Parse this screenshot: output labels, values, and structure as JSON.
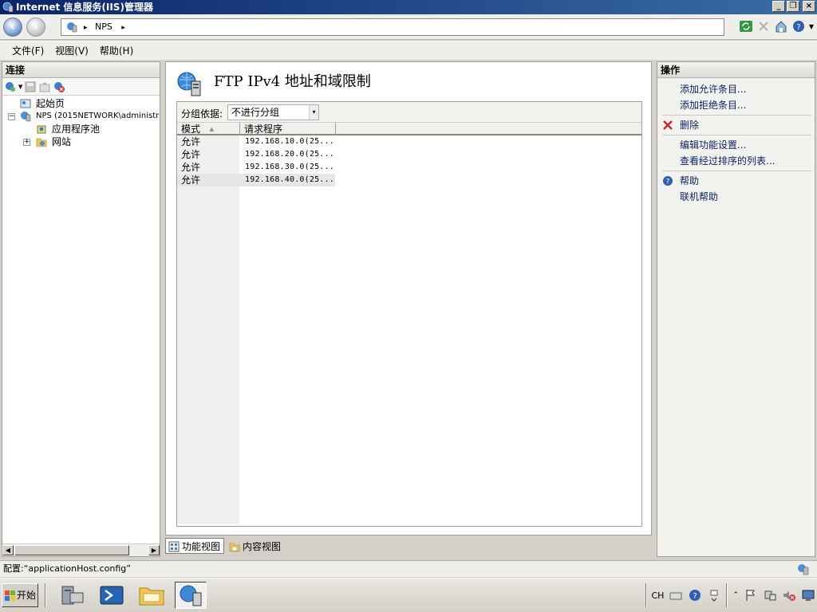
{
  "window": {
    "title": "Internet 信息服务(IIS)管理器",
    "min_label": "_",
    "max_label": "❐",
    "close_label": "×"
  },
  "address": {
    "back_label": "‹",
    "forward_label": "›",
    "sep1": "▸",
    "crumb": "NPS",
    "sep2": "▸"
  },
  "menu": [
    "文件(F)",
    "视图(V)",
    "帮助(H)"
  ],
  "connections": {
    "header": "连接",
    "tree": [
      {
        "label": "起始页"
      },
      {
        "label": "NPS (2015NETWORK\\administr",
        "expander": "−"
      },
      {
        "label": "应用程序池"
      },
      {
        "label": "网站",
        "expander": "+"
      }
    ],
    "scroll_left": "◀",
    "scroll_right": "▶"
  },
  "main": {
    "title": "FTP IPv4 地址和域限制",
    "group_label": "分组依据:",
    "group_value": "不进行分组",
    "dropdown_glyph": "▾",
    "columns": [
      "模式",
      "请求程序"
    ],
    "sort_glyph": "▲",
    "rows": [
      {
        "mode": "允许",
        "requester": "192.168.10.0(25..."
      },
      {
        "mode": "允许",
        "requester": "192.168.20.0(25..."
      },
      {
        "mode": "允许",
        "requester": "192.168.30.0(25..."
      },
      {
        "mode": "允许",
        "requester": "192.168.40.0(25..."
      }
    ]
  },
  "view_tabs": {
    "features": "功能视图",
    "content": "内容视图"
  },
  "actions": {
    "header": "操作",
    "add_allow": "添加允许条目...",
    "add_deny": "添加拒绝条目...",
    "delete": "删除",
    "edit_settings": "编辑功能设置...",
    "view_ordered": "查看经过排序的列表...",
    "help": "帮助",
    "online_help": "联机帮助"
  },
  "status": {
    "text": "配置:“applicationHost.config”"
  },
  "taskbar": {
    "start": "开始",
    "lang": "CH"
  },
  "colors": {
    "title_bar_start": "#0a246a",
    "title_bar_end": "#3a6ea5",
    "link": "#0a246a",
    "delete_x": "#d02020"
  }
}
